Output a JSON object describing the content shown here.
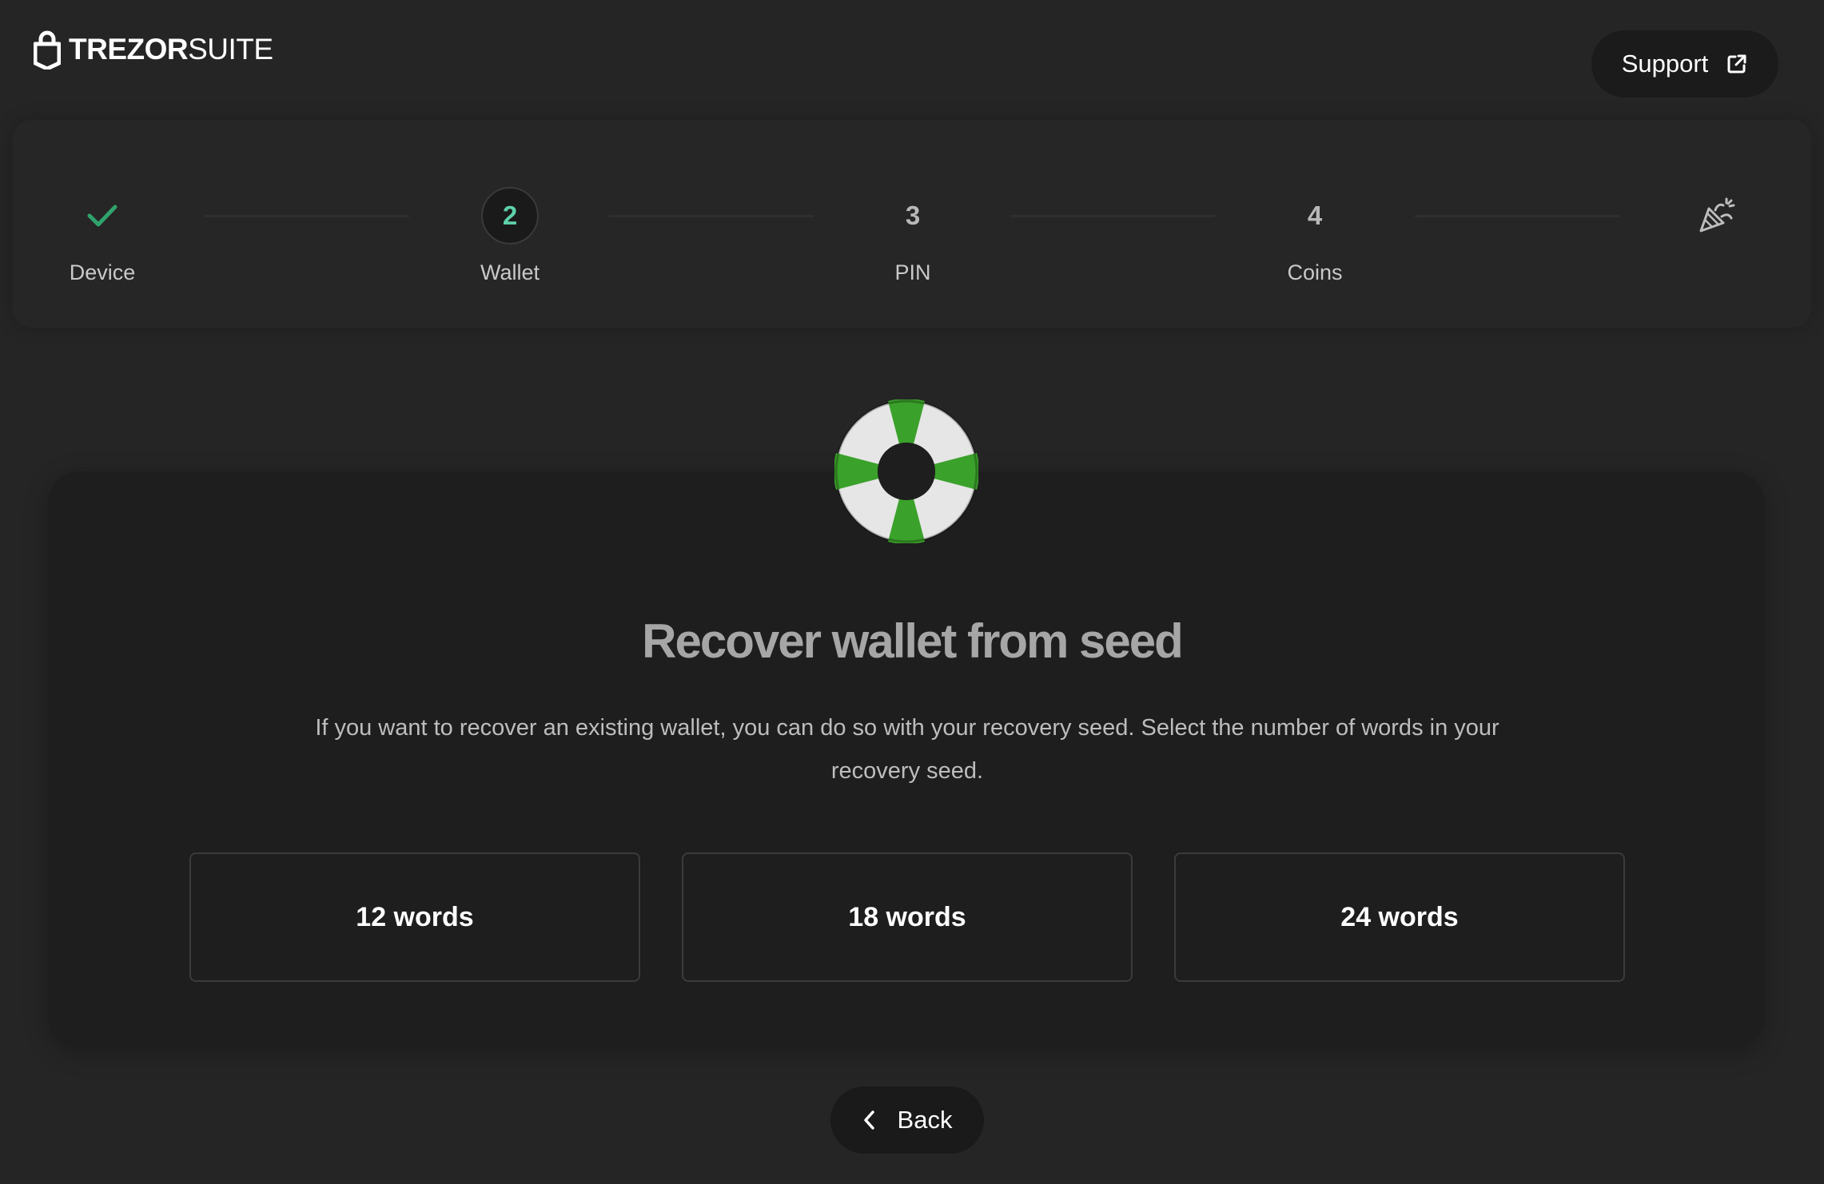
{
  "header": {
    "logo_bold": "TREZOR",
    "logo_light": "SUITE",
    "support_label": "Support"
  },
  "stepper": {
    "steps": [
      {
        "mark": "",
        "label": "Device",
        "state": "done"
      },
      {
        "mark": "2",
        "label": "Wallet",
        "state": "active"
      },
      {
        "mark": "3",
        "label": "PIN",
        "state": "pending"
      },
      {
        "mark": "4",
        "label": "Coins",
        "state": "pending"
      },
      {
        "mark": "",
        "label": "",
        "state": "final"
      }
    ]
  },
  "main": {
    "title": "Recover wallet from seed",
    "description": "If you want to recover an existing wallet, you can do so with your recovery seed. Select the number of words in your recovery seed.",
    "options": [
      "12 words",
      "18 words",
      "24 words"
    ]
  },
  "footer": {
    "back_label": "Back"
  },
  "icons": {
    "logo": "trezor-lock-icon",
    "support": "external-link-icon",
    "device_step": "check-icon",
    "final_step": "party-popper-icon",
    "hero": "lifebuoy-icon",
    "back": "chevron-left-icon"
  },
  "colors": {
    "accent": "#5ed1ab",
    "check": "#2fa36b",
    "lifebuoy_green": "#3aa12a",
    "background": "#252525",
    "card": "#1e1e1e"
  }
}
